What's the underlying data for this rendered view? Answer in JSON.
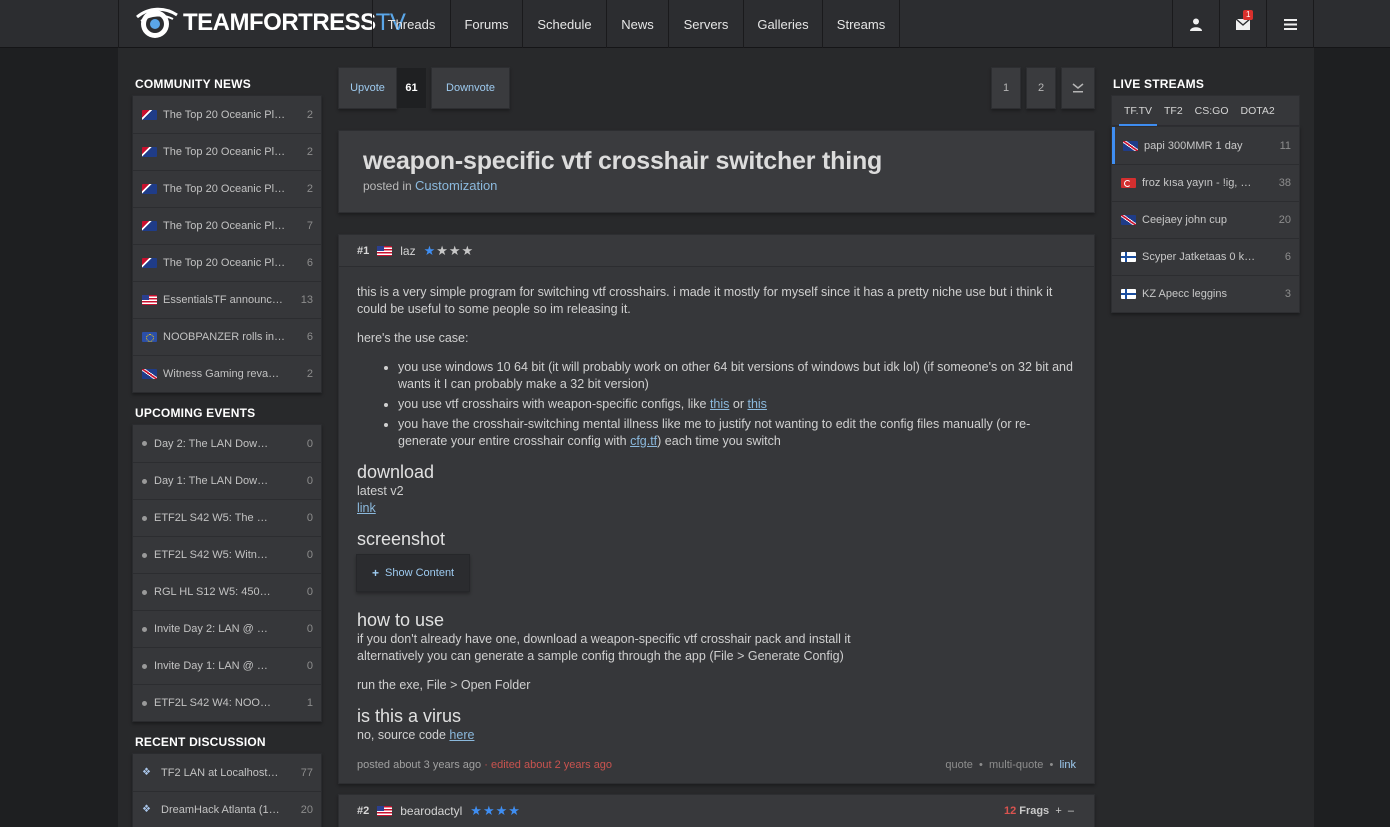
{
  "nav": {
    "logo_main": "TEAMFORTRESS",
    "logo_tv": "TV",
    "items": [
      "Threads",
      "Forums",
      "Schedule",
      "News",
      "Servers",
      "Galleries",
      "Streams"
    ],
    "inbox_badge": "1",
    "icons": [
      "user-icon",
      "mail-icon",
      "menu-icon"
    ]
  },
  "left": {
    "community_news_title": "COMMUNITY NEWS",
    "community_news": [
      {
        "flag": "au",
        "label": "The Top 20 Oceanic Pl…",
        "count": "2"
      },
      {
        "flag": "au",
        "label": "The Top 20 Oceanic Pl…",
        "count": "2"
      },
      {
        "flag": "au",
        "label": "The Top 20 Oceanic Pl…",
        "count": "2"
      },
      {
        "flag": "au",
        "label": "The Top 20 Oceanic Pl…",
        "count": "7"
      },
      {
        "flag": "au",
        "label": "The Top 20 Oceanic Pl…",
        "count": "6"
      },
      {
        "flag": "us",
        "label": "EssentialsTF announc…",
        "count": "13"
      },
      {
        "flag": "eu",
        "label": "NOOBPANZER rolls in…",
        "count": "6"
      },
      {
        "flag": "gb",
        "label": "Witness Gaming reva…",
        "count": "2"
      }
    ],
    "events_title": "UPCOMING EVENTS",
    "events": [
      {
        "label": "Day 2: The LAN Dow…",
        "count": "0"
      },
      {
        "label": "Day 1: The LAN Dow…",
        "count": "0"
      },
      {
        "label": "ETF2L S42 W5: The …",
        "count": "0"
      },
      {
        "label": "ETF2L S42 W5: Witn…",
        "count": "0"
      },
      {
        "label": "RGL HL S12 W5: 450…",
        "count": "0"
      },
      {
        "label": "Invite Day 2: LAN @ …",
        "count": "0"
      },
      {
        "label": "Invite Day 1: LAN @ …",
        "count": "0"
      },
      {
        "label": "ETF2L S42 W4: NOO…",
        "count": "1"
      }
    ],
    "discussion_title": "RECENT DISCUSSION",
    "discussion": [
      {
        "label": "TF2 LAN at Localhost…",
        "count": "77"
      },
      {
        "label": "DreamHack Atlanta (1…",
        "count": "20"
      }
    ]
  },
  "votes": {
    "upvote": "Upvote",
    "count": "61",
    "downvote": "Downvote"
  },
  "pager": {
    "pages": [
      "1",
      "2"
    ],
    "last_icon": "last-page-icon"
  },
  "thread": {
    "title": "weapon-specific vtf crosshair switcher thing",
    "posted_in": "posted in",
    "forum": "Customization"
  },
  "post1": {
    "num": "#1",
    "user": "laz",
    "stars_blue": "★",
    "stars_grey": "★★★",
    "intro": "this is a very simple program for switching vtf crosshairs. i made it mostly for myself since it has a pretty niche use but i think it could be useful to some people so im releasing it.",
    "usecase": "here's the use case:",
    "li1": "you use windows 10 64 bit (it will probably work on other 64 bit versions of windows but idk lol) (if someone's on 32 bit and wants it I can probably make a 32 bit version)",
    "li2_pre": "you use vtf crosshairs with weapon-specific configs, like ",
    "li2_link1": "this",
    "li2_mid": " or ",
    "li2_link2": "this",
    "li3_pre": "you have the crosshair-switching mental illness like me to justify not wanting to edit the config files manually (or re-generate your entire crosshair config with ",
    "li3_link": "cfg.tf",
    "li3_post": ") each time you switch",
    "download_h": "download",
    "download_ver": "latest v2",
    "download_link": "link",
    "screenshot_h": "screenshot",
    "show_content": "Show Content",
    "howto_h": "how to use",
    "howto_1": "if you don't already have one, download a weapon-specific vtf crosshair pack and install it",
    "howto_2": "alternatively you can generate a sample config through the app (File > Generate Config)",
    "howto_3": "run the exe, File > Open Folder",
    "virus_h": "is this a virus",
    "virus_pre": "no, source code ",
    "virus_link": "here",
    "posted": "posted about 3 years ago",
    "edited": "edited about 2 years ago",
    "quote": "quote",
    "multiquote": "multi-quote",
    "link": "link"
  },
  "post2": {
    "num": "#2",
    "user": "bearodactyl",
    "stars": "★★★★",
    "frags_count": "12",
    "frags_label": "Frags",
    "plus": "+",
    "minus": "–"
  },
  "streams": {
    "title": "LIVE STREAMS",
    "tabs": [
      "TF.TV",
      "TF2",
      "CS:GO",
      "DOTA2"
    ],
    "items": [
      {
        "flag": "gb",
        "label": "papi  300MMR 1 day",
        "count": "11"
      },
      {
        "flag": "tr",
        "label": "froz  kısa yayın - !ig, …",
        "count": "38"
      },
      {
        "flag": "gb",
        "label": "Ceejaey  john cup",
        "count": "20"
      },
      {
        "flag": "fi",
        "label": "Scyper  Jatketaas 0 k…",
        "count": "6"
      },
      {
        "flag": "fi",
        "label": "KZ  Apecc leggins",
        "count": "3"
      }
    ]
  },
  "colors": {
    "accent": "#3f8ef2",
    "link": "#8bb9dd",
    "frags": "#d9534f"
  }
}
